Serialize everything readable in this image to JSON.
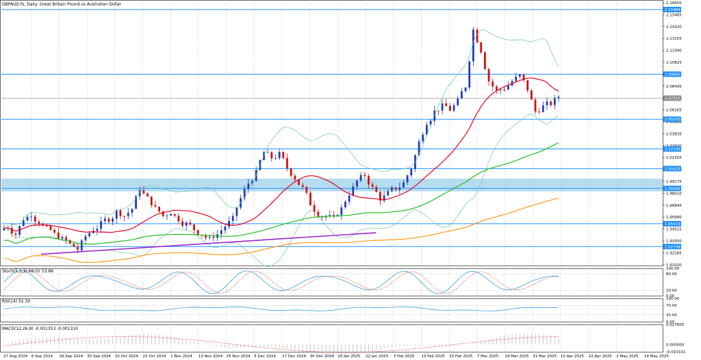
{
  "header": {
    "symbol_title": "GBPAUD.fs, Daily:  Great Britain Pound vs Australian Dollar"
  },
  "colors": {
    "bull": "#1f3fb0",
    "bear": "#d01010",
    "ma_red": "#e8001a",
    "ma_green": "#22bb22",
    "ma_orange": "#ff9a1a",
    "bollinger": "#67c8a6",
    "trendline": "#9b26c9",
    "level_line": "#1e90ff",
    "zone_fill": "#a9d6ec",
    "indicator_line": "#1e8fd6",
    "signal_dash": "#e03030",
    "grid": "#9a9a9a"
  },
  "chart_data": [
    {
      "type": "candlestick",
      "name": "main",
      "title": "GBPAUD.fs, Daily:  Great Britain Pound vs Australian Dollar",
      "x_labels": [
        "27 Aug 2024",
        "6 Sep 2024",
        "18 Sep 2024",
        "30 Sep 2024",
        "10 Oct 2024",
        "22 Oct 2024",
        "1 Nov 2024",
        "13 Nov 2024",
        "25 Nov 2024",
        "5 Dec 2024",
        "17 Dec 2024",
        "30 Dec 2024",
        "10 Jan 2025",
        "22 Jan 2025",
        "3 Feb 2025",
        "13 Feb 2025",
        "25 Feb 2025",
        "7 Mar 2025",
        "19 Mar 2025",
        "31 Mar 2025",
        "10 Apr 2025",
        "22 Apr 2025",
        "2 May 2025",
        "14 May 2025"
      ],
      "y_ticks": [
        "2.16650",
        "2.15485",
        "2.14320",
        "2.13155",
        "2.11990",
        "2.10825",
        "2.09660",
        "2.08495",
        "2.07330",
        "2.06165",
        "2.05000",
        "2.03835",
        "2.02670",
        "2.01505",
        "2.00340",
        "1.99175",
        "1.98010",
        "1.96845",
        "1.95680",
        "1.94515",
        "1.93350",
        "1.92185",
        "1.91020"
      ],
      "ylim": [
        1.9094,
        2.1692
      ],
      "price_tags": [
        {
          "label": "2.15984",
          "value": 2.15984
        },
        {
          "label": "2.09660",
          "value": 2.0966
        },
        {
          "label": "2.07315",
          "value": 2.07315
        },
        {
          "label": "2.05253",
          "value": 2.05253
        },
        {
          "label": "2.02346",
          "value": 2.02346
        },
        {
          "label": "2.00425",
          "value": 2.00425
        },
        {
          "label": "1.98486",
          "value": 1.98486
        },
        {
          "label": "1.95033",
          "value": 1.95033
        },
        {
          "label": "1.92798",
          "value": 1.92798
        }
      ],
      "level_lines": [
        2.15984,
        2.0966,
        2.05253,
        2.02346,
        2.00425,
        1.98486,
        1.95033,
        1.92798
      ],
      "current_price": 2.07315,
      "supply_zone": [
        1.982,
        1.9945
      ],
      "trendline": {
        "from": [
          "27 Aug 2024",
          1.9205
        ],
        "to": [
          "22 Jan 2025",
          1.9415
        ]
      },
      "ohlc_close_path": [
        1.948,
        1.94,
        1.955,
        1.96,
        1.952,
        1.945,
        1.94,
        1.935,
        1.93,
        1.925,
        1.938,
        1.945,
        1.95,
        1.955,
        1.962,
        1.958,
        1.965,
        1.985,
        1.975,
        1.965,
        1.958,
        1.962,
        1.955,
        1.95,
        1.945,
        1.94,
        1.935,
        1.94,
        1.948,
        1.955,
        1.975,
        1.99,
        2.0,
        2.02,
        2.015,
        2.018,
        2.005,
        1.995,
        1.985,
        1.97,
        1.96,
        1.958,
        1.955,
        1.965,
        1.98,
        1.992,
        1.998,
        1.985,
        1.975,
        1.98,
        1.985,
        1.99,
        2.005,
        2.03,
        2.05,
        2.06,
        2.065,
        2.062,
        2.07,
        2.085,
        2.14,
        2.12,
        2.09,
        2.08,
        2.083,
        2.09,
        2.095,
        2.082,
        2.06,
        2.065,
        2.068,
        2.075
      ]
    },
    {
      "type": "line",
      "name": "stochastic",
      "title": "Stoch(5,3,3) 69.01 53.86",
      "y_ticks": [
        "100.00",
        "80.00",
        "20.00",
        "0.00"
      ],
      "ylim": [
        0,
        100
      ],
      "levels": [
        80,
        20
      ]
    },
    {
      "type": "line",
      "name": "rsi",
      "title": "RSI(14) 51.30",
      "y_ticks": [
        "100.00",
        "70.00",
        "30.00",
        "0.00"
      ],
      "ylim": [
        0,
        100
      ],
      "levels": [
        70,
        30
      ]
    },
    {
      "type": "bar",
      "name": "macd",
      "title": "MACD(12,26,9) -0.001353 -0.001310",
      "y_ticks": [
        "0.027600",
        "0.000000",
        "-0.010101"
      ],
      "ylim": [
        -0.010101,
        0.0276
      ]
    }
  ]
}
